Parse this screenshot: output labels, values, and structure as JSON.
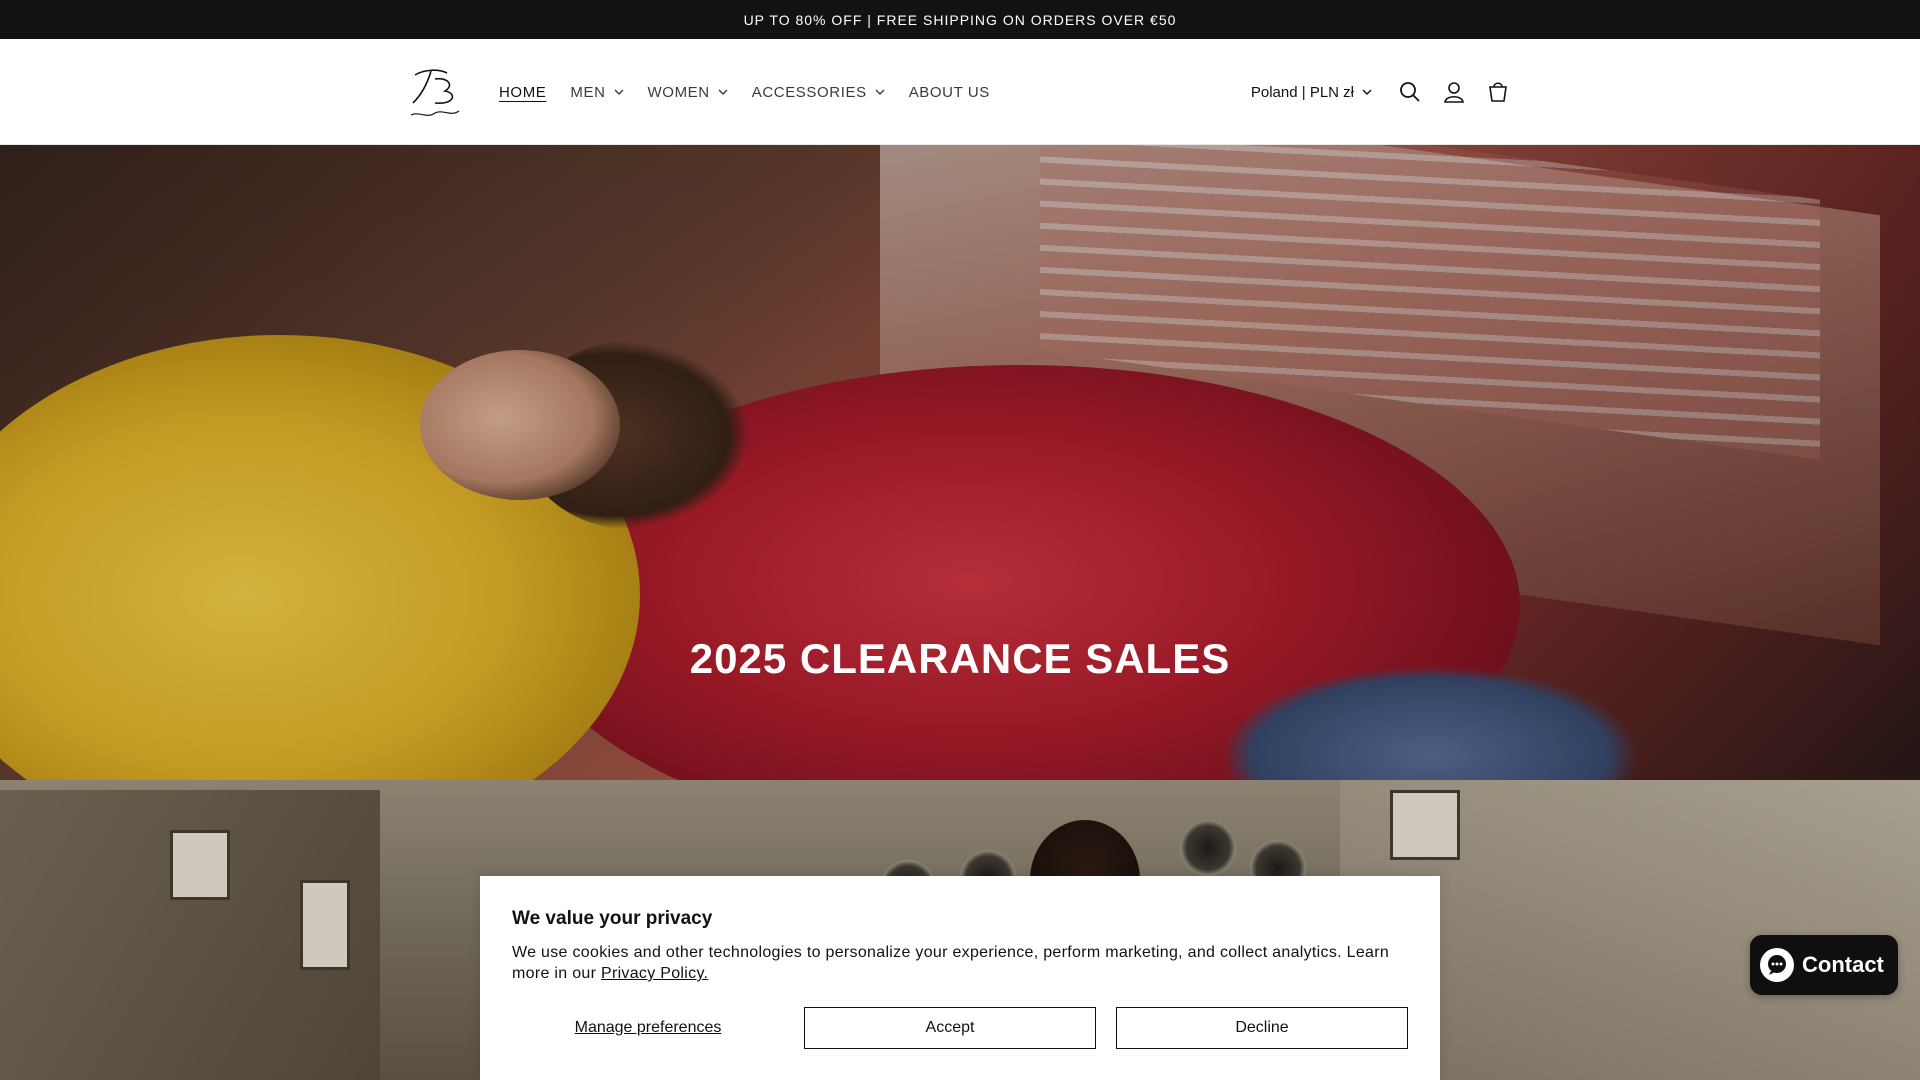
{
  "announcement": {
    "text": "UP TO 80% OFF | FREE SHIPPING ON ORDERS OVER €50"
  },
  "header": {
    "logo_alt": "Chandmilk",
    "nav": [
      {
        "label": "HOME",
        "active": true,
        "has_dropdown": false
      },
      {
        "label": "MEN",
        "active": false,
        "has_dropdown": true
      },
      {
        "label": "WOMEN",
        "active": false,
        "has_dropdown": true
      },
      {
        "label": "ACCESSORIES",
        "active": false,
        "has_dropdown": true
      },
      {
        "label": "ABOUT US",
        "active": false,
        "has_dropdown": false
      }
    ],
    "country_selector": "Poland | PLN zł",
    "icons": [
      "search-icon",
      "account-icon",
      "cart-icon"
    ]
  },
  "hero": {
    "title": "2025 CLEARANCE SALES"
  },
  "cookie_banner": {
    "title": "We value your privacy",
    "text": "We use cookies and other technologies to personalize your experience, perform marketing, and collect analytics. Learn more in our ",
    "link": "Privacy Policy.",
    "manage": "Manage preferences",
    "accept": "Accept",
    "decline": "Decline"
  },
  "contact_button": {
    "label": "Contact"
  },
  "colors": {
    "announce_bg": "#121212",
    "contact_bg": "#0f0f0f",
    "text": "#121212"
  }
}
